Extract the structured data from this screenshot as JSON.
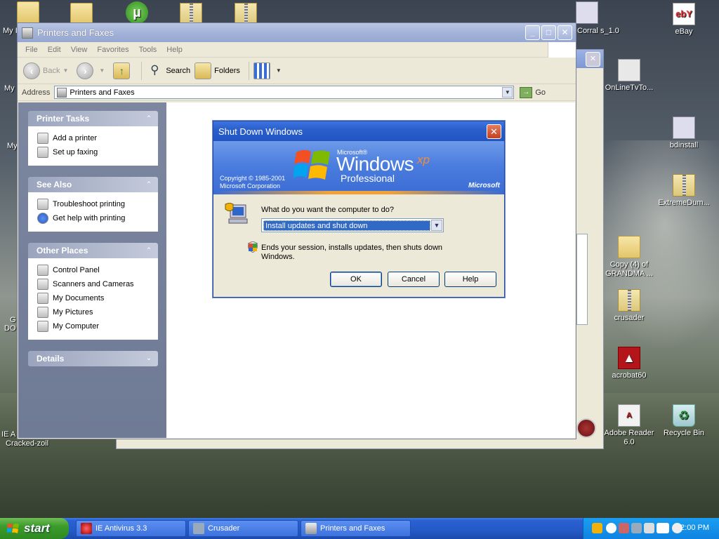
{
  "desktop": {
    "icons_right": [
      {
        "label": "ebay_label",
        "text": "eBay"
      },
      {
        "text": "OnLineTvTo..."
      },
      {
        "text": "bdinstall"
      },
      {
        "text": "ExtremeDum..."
      },
      {
        "text": "Copy (4) of GRANDMA ..."
      },
      {
        "text": "crusader"
      },
      {
        "text": "acrobat60"
      },
      {
        "text": "Adobe Reader 6.0"
      },
      {
        "text": "Recycle Bin"
      },
      {
        "text": "Corral s_1.0"
      }
    ],
    "left_partial": [
      "My I",
      "My",
      "My",
      "G",
      "DO",
      "IE A",
      "Cracked-zoil"
    ]
  },
  "explorer": {
    "title": "Printers and Faxes",
    "menu": [
      "File",
      "Edit",
      "View",
      "Favorites",
      "Tools",
      "Help"
    ],
    "toolbar": {
      "back": "Back",
      "search": "Search",
      "folders": "Folders"
    },
    "address": {
      "label": "Address",
      "value": "Printers and Faxes",
      "go": "Go"
    },
    "tasks": [
      {
        "title": "Printer Tasks",
        "items": [
          "Add a printer",
          "Set up faxing"
        ]
      },
      {
        "title": "See Also",
        "items": [
          "Troubleshoot printing",
          "Get help with printing"
        ]
      },
      {
        "title": "Other Places",
        "items": [
          "Control Panel",
          "Scanners and Cameras",
          "My Documents",
          "My Pictures",
          "My Computer"
        ]
      },
      {
        "title": "Details",
        "items": []
      }
    ]
  },
  "dialog": {
    "title": "Shut Down Windows",
    "banner": {
      "copyright_1": "Copyright © 1985-2001",
      "copyright_2": "Microsoft Corporation",
      "ms_small": "Microsoft®",
      "windows": "Windows",
      "xp": "xp",
      "edition": "Professional",
      "brand": "Microsoft"
    },
    "question": "What do you want the computer to do?",
    "selected_option": "Install updates and shut down",
    "description": "Ends your session, installs updates, then shuts down Windows.",
    "buttons": {
      "ok": "OK",
      "cancel": "Cancel",
      "help": "Help"
    }
  },
  "taskbar": {
    "start": "start",
    "tasks": [
      "IE Antivirus 3.3",
      "Crusader",
      "Printers and Faxes"
    ],
    "clock": "2:00 PM"
  },
  "colors": {
    "xp_blue": "#2054c2",
    "start_green": "#3c9b2b",
    "selection": "#316ac5"
  }
}
